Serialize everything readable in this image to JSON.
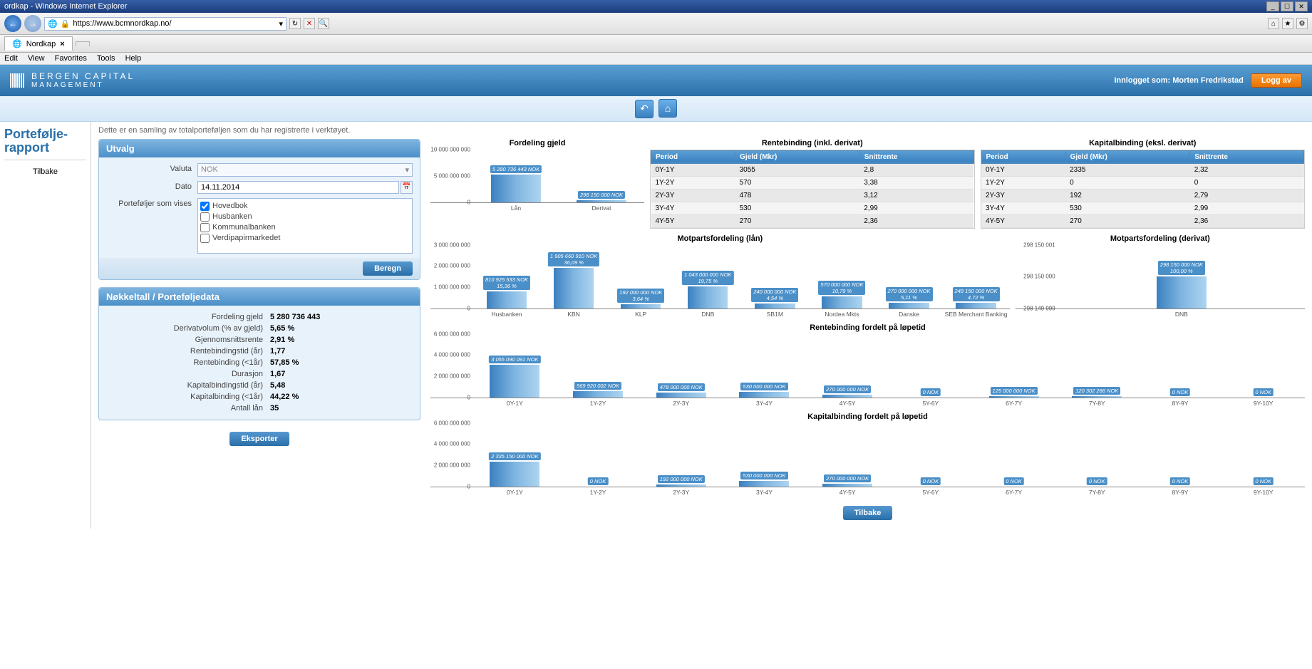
{
  "browser": {
    "window_title": "ordkap - Windows Internet Explorer",
    "url": "https://www.bcmnordkap.no/",
    "tab_name": "Nordkap",
    "menu": [
      "Edit",
      "View",
      "Favorites",
      "Tools",
      "Help"
    ]
  },
  "header": {
    "brand_line1": "BERGEN CAPITAL",
    "brand_line2": "MANAGEMENT",
    "login_label": "Innlogget som: Morten Fredrikstad",
    "logout_label": "Logg av"
  },
  "sidebar": {
    "title": "Portefølje-rapport",
    "items": [
      "Tilbake"
    ]
  },
  "intro": "Dette er en samling av totalporteføljen som du har registrerte i verktøyet.",
  "utvalg": {
    "title": "Utvalg",
    "valuta_label": "Valuta",
    "valuta_value": "NOK",
    "dato_label": "Dato",
    "dato_value": "14.11.2014",
    "pf_label": "Porteføljer som vises",
    "pf_options": [
      {
        "label": "Hovedbok",
        "checked": true
      },
      {
        "label": "Husbanken",
        "checked": false
      },
      {
        "label": "Kommunalbanken",
        "checked": false
      },
      {
        "label": "Verdipapirmarkedet",
        "checked": false
      }
    ],
    "beregn_label": "Beregn"
  },
  "nokkeltall": {
    "title": "Nøkkeltall / Porteføljedata",
    "rows": [
      {
        "k": "Fordeling gjeld",
        "v": "5 280 736 443"
      },
      {
        "k": "Derivatvolum (% av gjeld)",
        "v": "5,65 %"
      },
      {
        "k": "Gjennomsnittsrente",
        "v": "2,91 %"
      },
      {
        "k": "Rentebindingstid (år)",
        "v": "1,77"
      },
      {
        "k": "Rentebinding (<1år)",
        "v": "57,85 %"
      },
      {
        "k": "Durasjon",
        "v": "1,67"
      },
      {
        "k": "Kapitalbindingstid (år)",
        "v": "5,48"
      },
      {
        "k": "Kapitalbinding (<1år)",
        "v": "44,22 %"
      },
      {
        "k": "Antall lån",
        "v": "35"
      }
    ],
    "eksporter_label": "Eksporter"
  },
  "tables": {
    "rentebinding": {
      "title": "Rentebinding (inkl. derivat)",
      "headers": [
        "Period",
        "Gjeld (Mkr)",
        "Snittrente"
      ],
      "rows": [
        [
          "0Y-1Y",
          "3055",
          "2,8"
        ],
        [
          "1Y-2Y",
          "570",
          "3,38"
        ],
        [
          "2Y-3Y",
          "478",
          "3,12"
        ],
        [
          "3Y-4Y",
          "530",
          "2,99"
        ],
        [
          "4Y-5Y",
          "270",
          "2,36"
        ]
      ]
    },
    "kapitalbinding": {
      "title": "Kapitalbinding (eksl. derivat)",
      "headers": [
        "Period",
        "Gjeld (Mkr)",
        "Snittrente"
      ],
      "rows": [
        [
          "0Y-1Y",
          "2335",
          "2,32"
        ],
        [
          "1Y-2Y",
          "0",
          "0"
        ],
        [
          "2Y-3Y",
          "192",
          "2,79"
        ],
        [
          "3Y-4Y",
          "530",
          "2,99"
        ],
        [
          "4Y-5Y",
          "270",
          "2,36"
        ]
      ]
    }
  },
  "bottom": {
    "tilbake_label": "Tilbake"
  },
  "chart_data": [
    {
      "id": "fordeling_gjeld",
      "type": "bar",
      "title": "Fordeling gjeld",
      "categories": [
        "Lån",
        "Derivat"
      ],
      "values": [
        5280736443,
        298150000
      ],
      "labels": [
        "5 280 736 443 NOK",
        "298 150 000 NOK"
      ],
      "yticks": [
        "0",
        "5 000 000 000",
        "10 000 000 000"
      ],
      "ylim": [
        0,
        10000000000
      ]
    },
    {
      "id": "motparts_lan",
      "type": "bar",
      "title": "Motpartsfordeling (lån)",
      "categories": [
        "Husbanken",
        "KBN",
        "KLP",
        "DNB",
        "SB1M",
        "Nordea Mkts",
        "Danske",
        "SEB Merchant Banking"
      ],
      "values": [
        810925533,
        1905660910,
        192000000,
        1043000000,
        240000000,
        570000000,
        270000000,
        249150000
      ],
      "pct": [
        "15,36 %",
        "36,09 %",
        "3,64 %",
        "19,75 %",
        "4,54 %",
        "10,79 %",
        "5,11 %",
        "4,72 %"
      ],
      "labels": [
        "810 925 533 NOK",
        "1 905 660 910 NOK",
        "192 000 000 NOK",
        "1 043 000 000 NOK",
        "240 000 000 NOK",
        "570 000 000 NOK",
        "270 000 000 NOK",
        "249 150 000 NOK"
      ],
      "yticks": [
        "0",
        "1 000 000 000",
        "2 000 000 000",
        "3 000 000 000"
      ],
      "ylim": [
        0,
        3000000000
      ]
    },
    {
      "id": "motparts_derivat",
      "type": "bar",
      "title": "Motpartsfordeling (derivat)",
      "categories": [
        "DNB"
      ],
      "values": [
        298150000
      ],
      "pct": [
        "100,00 %"
      ],
      "labels": [
        "298 150 000 NOK"
      ],
      "yticks": [
        "298 149 999",
        "298 150 000",
        "298 150 001"
      ],
      "ylim": [
        298149999,
        298150001
      ]
    },
    {
      "id": "rentebinding_lopetid",
      "type": "bar",
      "title": "Rentebinding fordelt på løpetid",
      "categories": [
        "0Y-1Y",
        "1Y-2Y",
        "2Y-3Y",
        "3Y-4Y",
        "4Y-5Y",
        "5Y-6Y",
        "6Y-7Y",
        "7Y-8Y",
        "8Y-9Y",
        "9Y-10Y"
      ],
      "values": [
        3055090091,
        569920002,
        478000000,
        530000000,
        270000000,
        0,
        125000000,
        120302286,
        0,
        0
      ],
      "labels": [
        "3 055 090 091 NOK",
        "569 920 002 NOK",
        "478 000 000 NOK",
        "530 000 000 NOK",
        "270 000 000 NOK",
        "0 NOK",
        "125 000 000 NOK",
        "120 302 286 NOK",
        "0 NOK",
        "0 NOK"
      ],
      "yticks": [
        "0",
        "2 000 000 000",
        "4 000 000 000",
        "6 000 000 000"
      ],
      "ylim": [
        0,
        6000000000
      ]
    },
    {
      "id": "kapitalbinding_lopetid",
      "type": "bar",
      "title": "Kapitalbinding fordelt på løpetid",
      "categories": [
        "0Y-1Y",
        "1Y-2Y",
        "2Y-3Y",
        "3Y-4Y",
        "4Y-5Y",
        "5Y-6Y",
        "6Y-7Y",
        "7Y-8Y",
        "8Y-9Y",
        "9Y-10Y"
      ],
      "values": [
        2335150000,
        0,
        192000000,
        530000000,
        270000000,
        0,
        0,
        0,
        0,
        0
      ],
      "labels": [
        "2 335 150 000 NOK",
        "0 NOK",
        "192 000 000 NOK",
        "530 000 000 NOK",
        "270 000 000 NOK",
        "0 NOK",
        "0 NOK",
        "0 NOK",
        "0 NOK",
        "0 NOK"
      ],
      "yticks": [
        "0",
        "2 000 000 000",
        "4 000 000 000",
        "6 000 000 000"
      ],
      "ylim": [
        0,
        6000000000
      ]
    }
  ]
}
